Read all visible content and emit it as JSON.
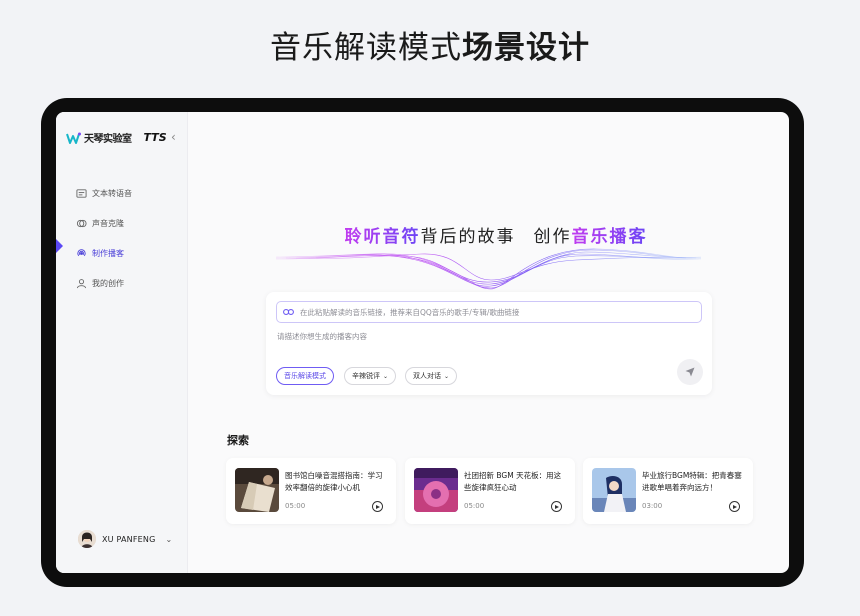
{
  "headline": {
    "regular": "音乐解读模式",
    "bold": "场景设计"
  },
  "app": {
    "logo_text": "天琴实验室",
    "logo_suffix": "TTS",
    "collapse_icon": "chevron-left"
  },
  "sidebar": {
    "items": [
      {
        "label": "文本转语音",
        "icon": "document-text-icon"
      },
      {
        "label": "声音克隆",
        "icon": "voice-clone-icon"
      },
      {
        "label": "制作播客",
        "icon": "podcast-icon",
        "active": true
      },
      {
        "label": "我的创作",
        "icon": "user-icon"
      }
    ]
  },
  "user": {
    "name": "XU PANFENG"
  },
  "hero": {
    "part1": "聆听音符",
    "part2": "背后的故事",
    "part3": "创作",
    "part4": "音乐播客"
  },
  "input": {
    "link_placeholder": "在此粘贴解读的音乐链接，推荐来自QQ音乐的歌手/专辑/歌曲链接",
    "desc_placeholder": "请描述你想生成的播客内容",
    "chips": {
      "mode": "音乐解读模式",
      "style": "辛辣锐评",
      "format": "双人对话"
    }
  },
  "explore": {
    "title": "探索",
    "cards": [
      {
        "title": "图书馆白噪音混搭指南：学习效率翻倍的旋律小心机",
        "duration": "05:00"
      },
      {
        "title": "社团招新 BGM 天花板：用这些旋律疯狂心动",
        "duration": "05:00"
      },
      {
        "title": "毕业旅行BGM特辑：把青春塞进歌单唱着奔向远方！",
        "duration": "03:00"
      }
    ]
  },
  "colors": {
    "accent": "#5b49f5",
    "gradient_start": "#c13cf0",
    "gradient_end": "#6a45f5"
  }
}
